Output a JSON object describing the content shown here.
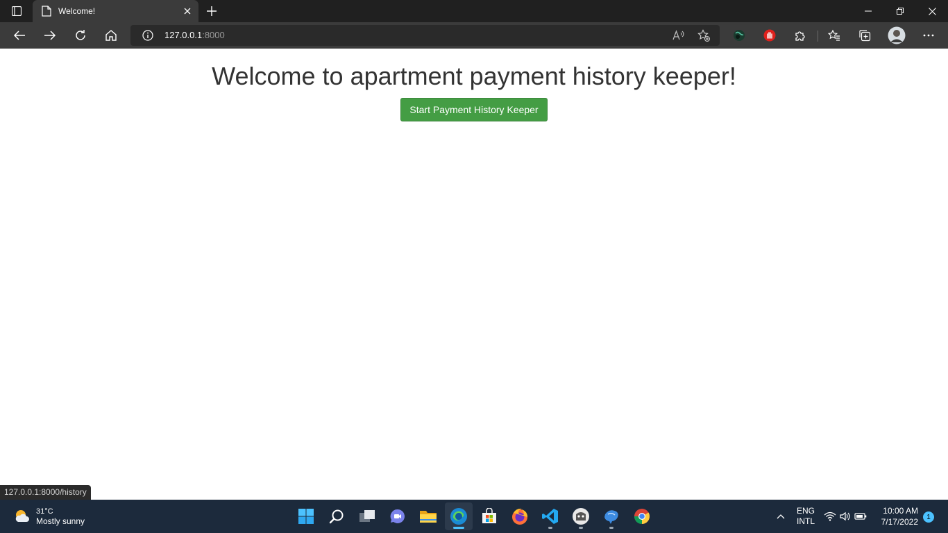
{
  "browser": {
    "tab_title": "Welcome!",
    "url_host": "127.0.0.1",
    "url_port": ":8000",
    "status_url": "127.0.0.1:8000/history"
  },
  "page": {
    "heading": "Welcome to apartment payment history keeper!",
    "start_button_label": "Start Payment History Keeper",
    "button_color": "#449d44"
  },
  "taskbar": {
    "weather_temp": "31°C",
    "weather_condition": "Mostly sunny",
    "lang_line1": "ENG",
    "lang_line2": "INTL",
    "time": "10:00 AM",
    "date": "7/17/2022",
    "notification_count": "1",
    "apps": [
      "start-icon",
      "search-icon",
      "task-view-icon",
      "teams-chat-icon",
      "file-explorer-icon",
      "edge-icon",
      "store-icon",
      "firefox-icon",
      "vscode-icon",
      "app-icon",
      "dolphin-icon",
      "chrome-icon"
    ]
  }
}
